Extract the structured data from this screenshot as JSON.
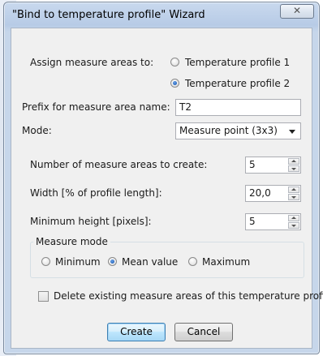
{
  "window": {
    "title": "\"Bind to temperature profile\" Wizard",
    "close_glyph": "✕"
  },
  "assign": {
    "label": "Assign measure areas to:",
    "options": [
      "Temperature profile 1",
      "Temperature profile 2"
    ],
    "selected": 1
  },
  "prefix": {
    "label": "Prefix for measure area name:",
    "value": "T2"
  },
  "mode": {
    "label": "Mode:",
    "value": "Measure point (3x3)"
  },
  "count": {
    "label": "Number of measure areas to create:",
    "value": "5"
  },
  "width": {
    "label": "Width [% of profile length]:",
    "value": "20,0"
  },
  "min_height": {
    "label": "Minimum height [pixels]:",
    "value": "5"
  },
  "measure_mode": {
    "title": "Measure mode",
    "options": [
      "Minimum",
      "Mean value",
      "Maximum"
    ],
    "selected": 1
  },
  "delete_existing": {
    "label": "Delete existing measure areas of this temperature profile",
    "checked": false
  },
  "buttons": {
    "create": "Create",
    "cancel": "Cancel"
  }
}
